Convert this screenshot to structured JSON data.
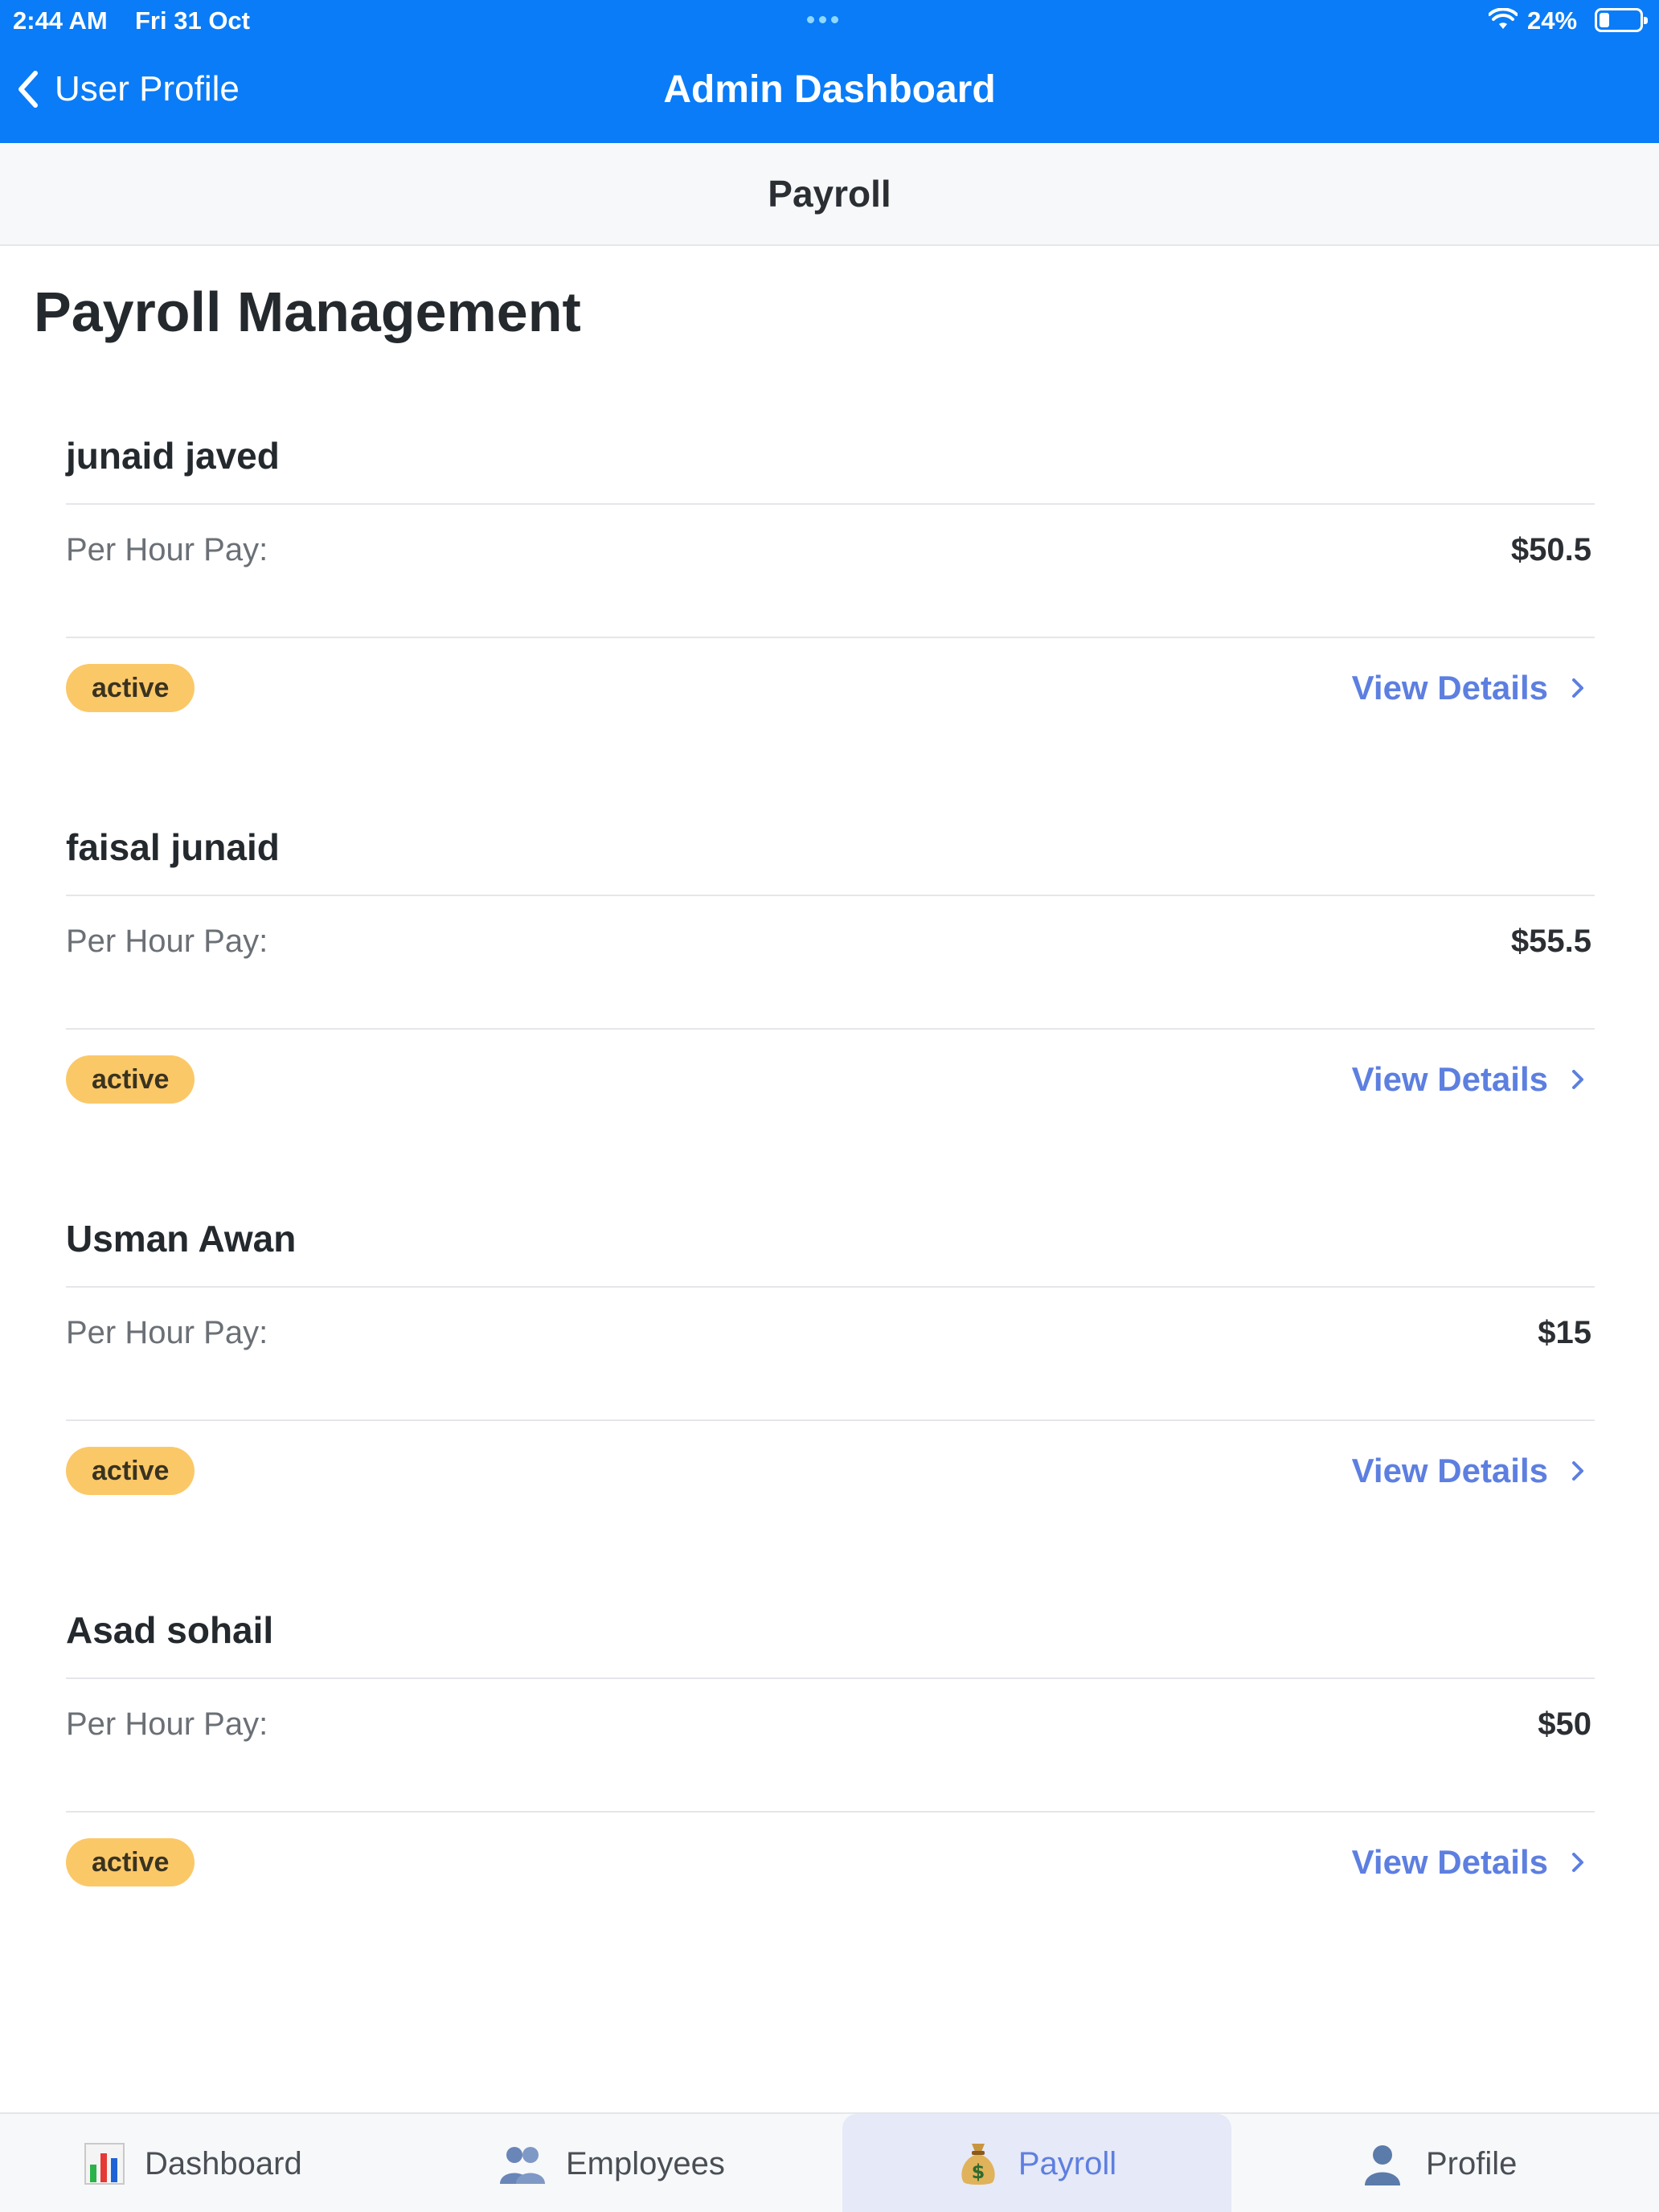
{
  "status_bar": {
    "time": "2:44 AM",
    "date": "Fri 31 Oct",
    "battery_percent": "24%",
    "battery_level": 0.24
  },
  "nav": {
    "back_label": "User Profile",
    "title": "Admin Dashboard"
  },
  "subheader": {
    "title": "Payroll"
  },
  "page": {
    "title": "Payroll Management"
  },
  "employees": [
    {
      "name": "junaid javed",
      "pay_label": "Per Hour Pay:",
      "pay_value": "$50.5",
      "status": "active",
      "details_label": "View Details"
    },
    {
      "name": "faisal junaid",
      "pay_label": "Per Hour Pay:",
      "pay_value": "$55.5",
      "status": "active",
      "details_label": "View Details"
    },
    {
      "name": "Usman Awan",
      "pay_label": "Per Hour Pay:",
      "pay_value": "$15",
      "status": "active",
      "details_label": "View Details"
    },
    {
      "name": "Asad sohail",
      "pay_label": "Per Hour Pay:",
      "pay_value": "$50",
      "status": "active",
      "details_label": "View Details"
    }
  ],
  "tabbar": {
    "items": [
      {
        "label": "Dashboard",
        "icon": "bar-chart-icon"
      },
      {
        "label": "Employees",
        "icon": "people-icon"
      },
      {
        "label": "Payroll",
        "icon": "money-bag-icon",
        "active": true
      },
      {
        "label": "Profile",
        "icon": "person-icon"
      }
    ]
  },
  "colors": {
    "nav_blue": "#0a7cf7",
    "accent": "#5d7fe0",
    "badge": "#fbc868",
    "active_tab_bg": "#e6e9f7"
  }
}
